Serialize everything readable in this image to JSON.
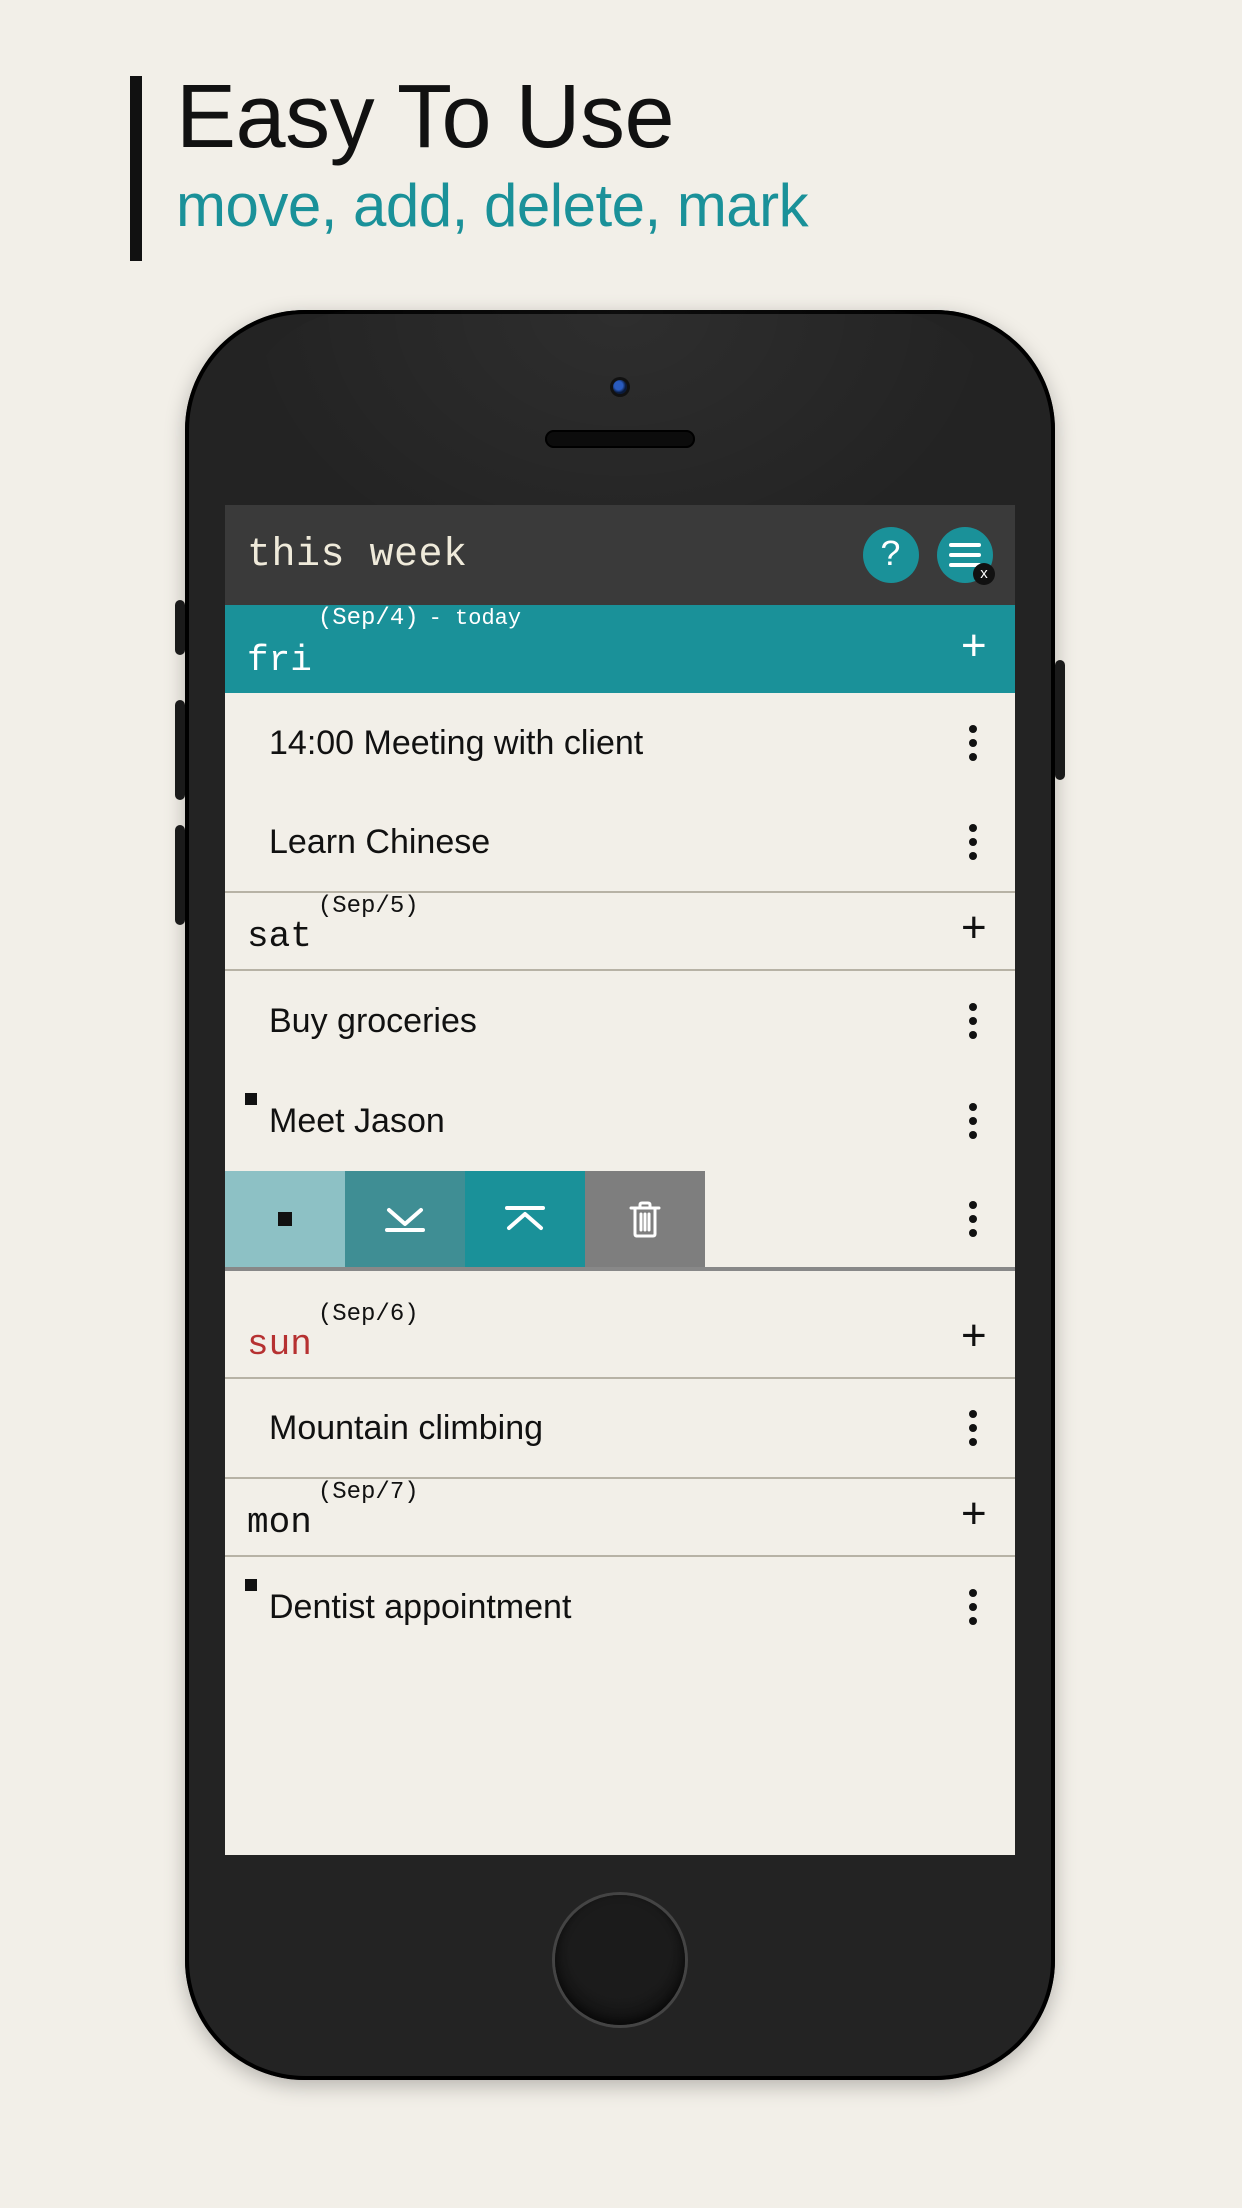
{
  "headline": {
    "title": "Easy To Use",
    "subtitle": "move, add, delete, mark"
  },
  "app": {
    "title": "this week",
    "help_label": "?",
    "menu_close_badge": "x"
  },
  "colors": {
    "accent": "#1a9199",
    "sunday": "#b63131"
  },
  "days": [
    {
      "key": "fri",
      "name": "fri",
      "date": "(Sep/4)",
      "tag": "- today",
      "today": true,
      "tasks": [
        {
          "text": "14:00 Meeting with client",
          "marked": false
        },
        {
          "text": "Learn Chinese",
          "marked": false
        }
      ]
    },
    {
      "key": "sat",
      "name": "sat",
      "date": "(Sep/5)",
      "tasks": [
        {
          "text": "Buy groceries",
          "marked": false
        },
        {
          "text": "Meet Jason",
          "marked": true
        }
      ],
      "action_bar": true
    },
    {
      "key": "sun",
      "name": "sun",
      "date": "(Sep/6)",
      "sunday": true,
      "tasks": [
        {
          "text": "Mountain climbing",
          "marked": false
        }
      ]
    },
    {
      "key": "mon",
      "name": "mon",
      "date": "(Sep/7)",
      "tasks": [
        {
          "text": "Dentist appointment",
          "marked": true
        }
      ]
    }
  ],
  "action_bar": {
    "mark": "mark",
    "move_down": "move down",
    "move_up": "move up",
    "delete": "delete"
  }
}
